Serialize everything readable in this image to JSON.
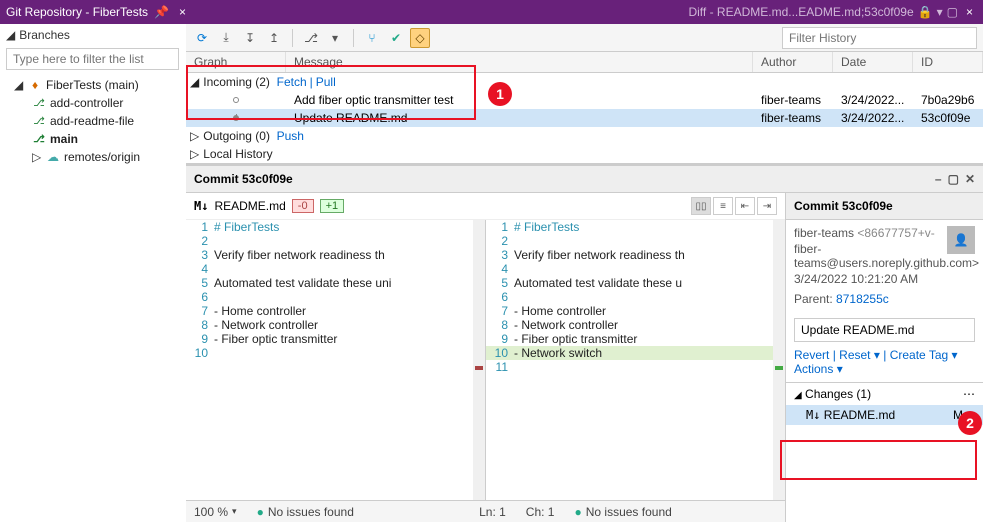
{
  "titleBar": {
    "leftTitle": "Git Repository - FiberTests",
    "rightTitle": "Diff - README.md...EADME.md;53c0f09e"
  },
  "sidebar": {
    "header": "Branches",
    "filterPlaceholder": "Type here to filter the list",
    "repoName": "FiberTests (main)",
    "branches": [
      "add-controller",
      "add-readme-file",
      "main"
    ],
    "remotes": "remotes/origin"
  },
  "filterHistoryPlaceholder": "Filter History",
  "gridHeaders": {
    "graph": "Graph",
    "message": "Message",
    "author": "Author",
    "date": "Date",
    "id": "ID"
  },
  "groups": {
    "incoming": "Incoming (2)",
    "fetch": "Fetch",
    "pull": "Pull",
    "outgoing": "Outgoing (0)",
    "push": "Push",
    "localHistory": "Local History"
  },
  "commits": [
    {
      "msg": "Add fiber optic transmitter test",
      "author": "fiber-teams",
      "date": "3/24/2022...",
      "id": "7b0a29b6"
    },
    {
      "msg": "Update README.md",
      "author": "fiber-teams",
      "date": "3/24/2022...",
      "id": "53c0f09e"
    }
  ],
  "commitPanel": {
    "title": "Commit 53c0f09e",
    "file": "README.md",
    "badgeDel": "-0",
    "badgeAdd": "+1"
  },
  "diffLeft": [
    {
      "n": "1",
      "t": "# FiberTests",
      "cls": "md-h"
    },
    {
      "n": "2",
      "t": ""
    },
    {
      "n": "3",
      "t": "Verify fiber network readiness th"
    },
    {
      "n": "4",
      "t": ""
    },
    {
      "n": "5",
      "t": "Automated test validate these uni"
    },
    {
      "n": "6",
      "t": ""
    },
    {
      "n": "7",
      "t": "- Home controller"
    },
    {
      "n": "8",
      "t": "- Network controller"
    },
    {
      "n": "9",
      "t": "- Fiber optic transmitter"
    },
    {
      "n": "",
      "t": "",
      "cls": "deleted-bg"
    },
    {
      "n": "10",
      "t": ""
    }
  ],
  "diffRight": [
    {
      "n": "1",
      "t": "# FiberTests",
      "cls": "md-h"
    },
    {
      "n": "2",
      "t": ""
    },
    {
      "n": "3",
      "t": "Verify fiber network readiness th"
    },
    {
      "n": "4",
      "t": ""
    },
    {
      "n": "5",
      "t": "Automated test validate these u"
    },
    {
      "n": "6",
      "t": ""
    },
    {
      "n": "7",
      "t": "- Home controller"
    },
    {
      "n": "8",
      "t": "- Network controller"
    },
    {
      "n": "9",
      "t": "- Fiber optic transmitter"
    },
    {
      "n": "10",
      "t": "- Network switch",
      "cls": "added-bg"
    },
    {
      "n": "11",
      "t": ""
    }
  ],
  "commitDetails": {
    "title": "Commit 53c0f09e",
    "author": "fiber-teams",
    "authorId": "<86677757+v-",
    "email": "fiber-teams@users.noreply.github.com>",
    "date": "3/24/2022 10:21:20 AM",
    "parentLabel": "Parent:",
    "parentHash": "8718255c",
    "message": "Update README.md",
    "actions": {
      "revert": "Revert",
      "reset": "Reset",
      "createTag": "Create Tag",
      "more": "Actions"
    },
    "changesHeader": "Changes (1)",
    "changedFile": "README.md",
    "changeMark": "M"
  },
  "statusBar": {
    "zoom": "100 %",
    "issues": "No issues found",
    "ln": "Ln: 1",
    "ch": "Ch: 1",
    "issues2": "No issues found"
  },
  "callouts": {
    "b1": "1",
    "b2": "2"
  }
}
